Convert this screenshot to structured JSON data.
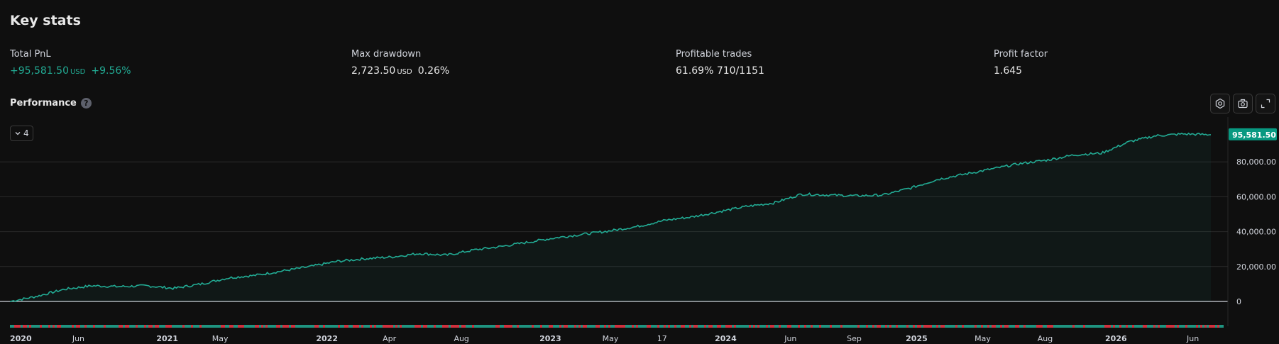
{
  "page": {
    "title": "Key stats"
  },
  "stats": [
    {
      "label": "Total PnL",
      "value": "+95,581.50",
      "currency": "USD",
      "extra": "+9.56%",
      "positive": true
    },
    {
      "label": "Max drawdown",
      "value": "2,723.50",
      "currency": "USD",
      "extra": "0.26%",
      "positive": false
    },
    {
      "label": "Profitable trades",
      "value": "61.69%",
      "currency": "",
      "extra": "710/1151",
      "positive": false
    },
    {
      "label": "Profit factor",
      "value": "1.645",
      "currency": "",
      "extra": "",
      "positive": false
    }
  ],
  "performance": {
    "label": "Performance",
    "help_icon": "question-icon",
    "dropdown_value": "4",
    "toolbar_icons": [
      "settings-icon",
      "camera-icon",
      "fullscreen-icon"
    ]
  },
  "colors": {
    "positive": "#22ab94",
    "negative": "#f23645",
    "line": "#22ab94",
    "background": "#0f0f0f"
  },
  "chart_data": {
    "type": "area",
    "y_ticks": [
      "80,000.00",
      "60,000.00",
      "40,000.00",
      "20,000.00",
      "0"
    ],
    "y_tick_values": [
      80000,
      60000,
      40000,
      20000,
      0
    ],
    "ylim": [
      0,
      100000
    ],
    "last_value_label": "95,581.50",
    "x_ticks": [
      {
        "label": "2020",
        "bold": true
      },
      {
        "label": "Jun",
        "bold": false
      },
      {
        "label": "2021",
        "bold": true
      },
      {
        "label": "May",
        "bold": false
      },
      {
        "label": "2022",
        "bold": true
      },
      {
        "label": "Apr",
        "bold": false
      },
      {
        "label": "Aug",
        "bold": false
      },
      {
        "label": "2023",
        "bold": true
      },
      {
        "label": "May",
        "bold": false
      },
      {
        "label": "17",
        "bold": false
      },
      {
        "label": "2024",
        "bold": true
      },
      {
        "label": "Jun",
        "bold": false
      },
      {
        "label": "Sep",
        "bold": false
      },
      {
        "label": "2025",
        "bold": true
      },
      {
        "label": "May",
        "bold": false
      },
      {
        "label": "Aug",
        "bold": false
      },
      {
        "label": "2026",
        "bold": true
      },
      {
        "label": "Jun",
        "bold": false
      }
    ],
    "x_tick_positions": [
      0.0,
      0.057,
      0.131,
      0.175,
      0.264,
      0.316,
      0.376,
      0.45,
      0.5,
      0.543,
      0.596,
      0.65,
      0.703,
      0.755,
      0.81,
      0.862,
      0.921,
      0.985
    ],
    "series": [
      {
        "values": [
          0,
          3000,
          7000,
          9000,
          8500,
          9000,
          7500,
          10000,
          13500,
          15000,
          17500,
          20000,
          23000,
          24500,
          25500,
          27500,
          26500,
          29500,
          31500,
          34000,
          36500,
          38500,
          40500,
          43000,
          46500,
          48500,
          51500,
          54500,
          56500,
          61500,
          61000,
          60500,
          61000,
          65000,
          70000,
          73000,
          76000,
          79000,
          81000,
          84000,
          85000,
          91500,
          95000,
          96000,
          95581.5
        ]
      }
    ],
    "grid": true
  }
}
